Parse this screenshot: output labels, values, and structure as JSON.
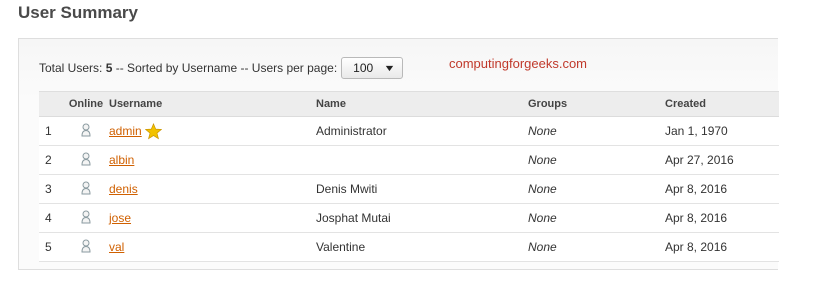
{
  "page": {
    "title": "User Summary"
  },
  "toolbar": {
    "total_label": "Total Users:",
    "total_count": "5",
    "sort_text": "-- Sorted by Username -- Users per page:",
    "per_page_value": "100"
  },
  "watermark": "computingforgeeks.com",
  "table": {
    "headers": {
      "num": "",
      "online": "Online",
      "username": "Username",
      "name": "Name",
      "groups": "Groups",
      "created": "Created"
    },
    "rows": [
      {
        "num": "1",
        "username": "admin",
        "name": "Administrator",
        "groups": "None",
        "created": "Jan 1, 1970",
        "admin_star": true
      },
      {
        "num": "2",
        "username": "albin",
        "name": "",
        "groups": "None",
        "created": "Apr 27, 2016"
      },
      {
        "num": "3",
        "username": "denis",
        "name": "Denis Mwiti",
        "groups": "None",
        "created": "Apr 8, 2016"
      },
      {
        "num": "4",
        "username": "jose",
        "name": "Josphat Mutai",
        "groups": "None",
        "created": "Apr 8, 2016"
      },
      {
        "num": "5",
        "username": "val",
        "name": "Valentine",
        "groups": "None",
        "created": "Apr 8, 2016"
      }
    ]
  },
  "icons": {
    "online_status": "user-offline-icon",
    "admin_badge": "star-icon",
    "dropdown": "chevron-down-icon"
  },
  "colors": {
    "link": "#d06000",
    "watermark": "#c0392b",
    "star": "#f2c200"
  }
}
